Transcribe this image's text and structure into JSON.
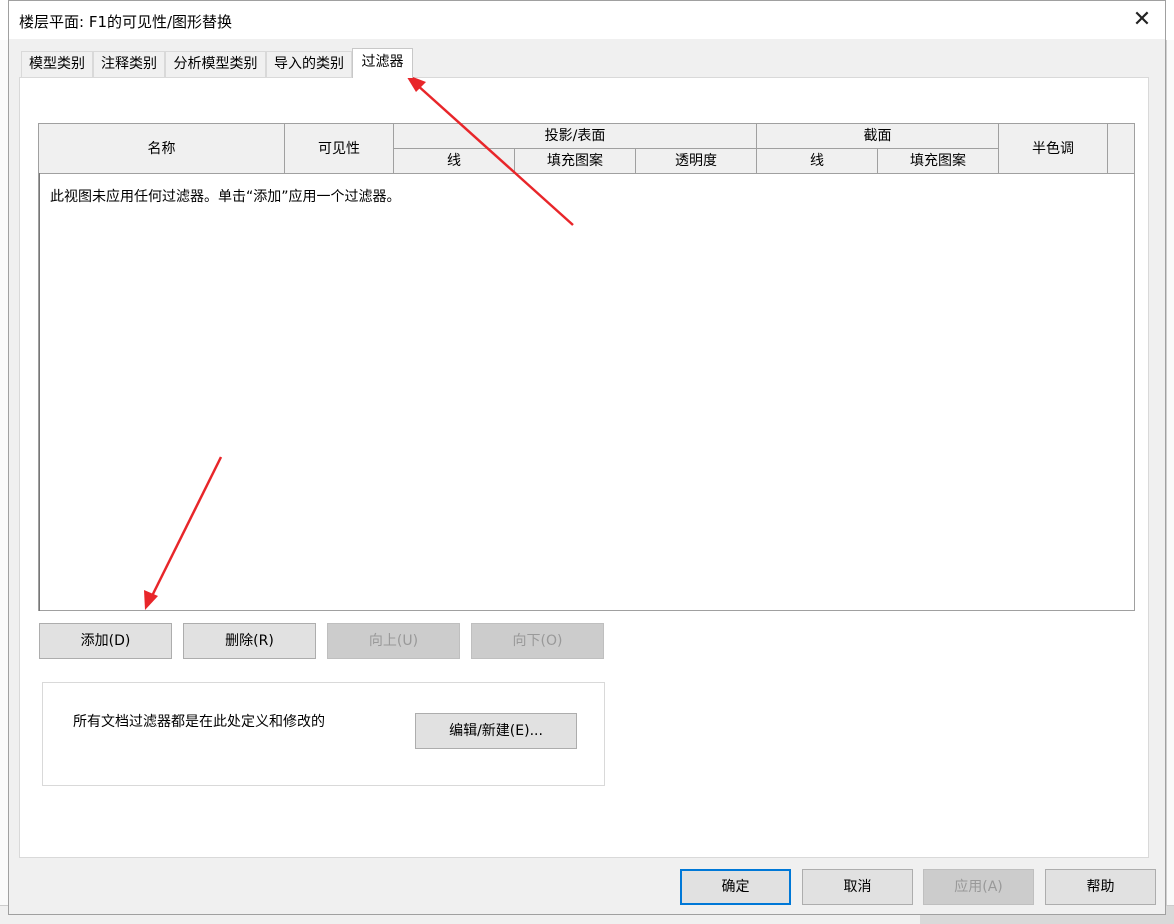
{
  "window": {
    "title": "楼层平面: F1的可见性/图形替换",
    "close_glyph": "✕"
  },
  "tabs": [
    {
      "label": "模型类别",
      "active": false
    },
    {
      "label": "注释类别",
      "active": false
    },
    {
      "label": "分析模型类别",
      "active": false
    },
    {
      "label": "导入的类别",
      "active": false
    },
    {
      "label": "过滤器",
      "active": true
    }
  ],
  "table": {
    "columns": {
      "name": "名称",
      "visibility": "可见性",
      "projection_surface": "投影/表面",
      "proj_line": "线",
      "proj_fill": "填充图案",
      "proj_transparency": "透明度",
      "cut": "截面",
      "cut_line": "线",
      "cut_fill": "填充图案",
      "halftone": "半色调"
    },
    "empty_message": "此视图未应用任何过滤器。单击“添加”应用一个过滤器。"
  },
  "row_buttons": {
    "add": "添加(D)",
    "remove": "删除(R)",
    "up": "向上(U)",
    "down": "向下(O)"
  },
  "filters_box": {
    "message": "所有文档过滤器都是在此处定义和修改的",
    "edit_new": "编辑/新建(E)..."
  },
  "footer": {
    "ok": "确定",
    "cancel": "取消",
    "apply": "应用(A)",
    "help": "帮助"
  },
  "colors": {
    "annotation_arrow": "#e8262a",
    "focus_border": "#0078d7"
  }
}
